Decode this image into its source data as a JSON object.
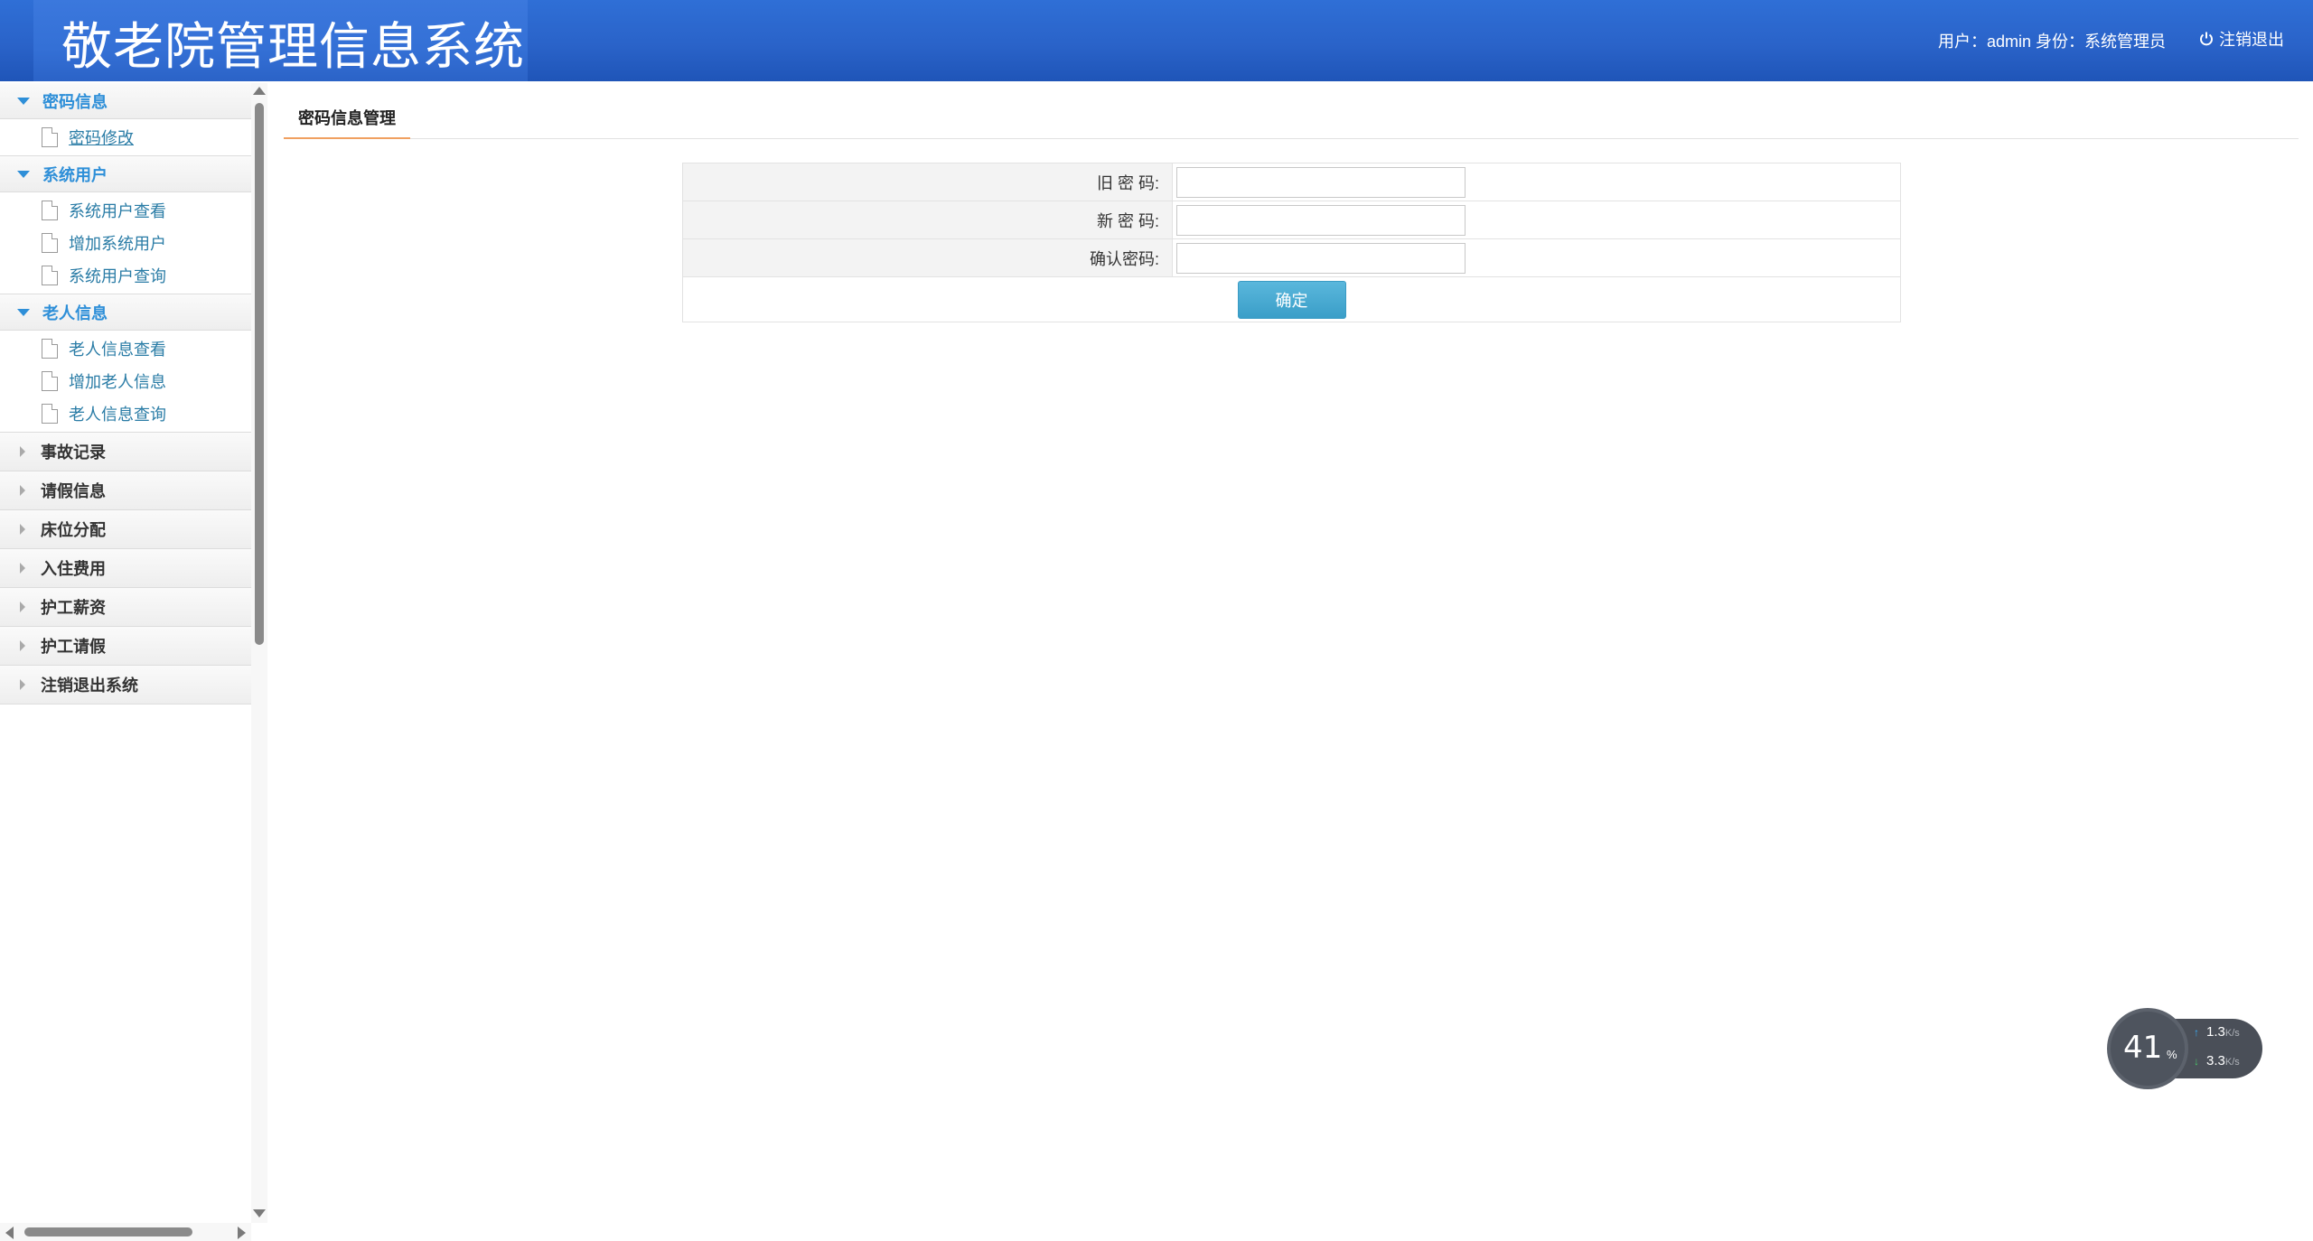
{
  "header": {
    "app_title": "敬老院管理信息系统",
    "user_info": "用户：admin 身份：系统管理员",
    "logout_label": "注销退出"
  },
  "sidebar": {
    "groups": [
      {
        "label": "密码信息",
        "expanded": true,
        "items": [
          {
            "label": "密码修改",
            "active": true
          }
        ]
      },
      {
        "label": "系统用户",
        "expanded": true,
        "items": [
          {
            "label": "系统用户查看"
          },
          {
            "label": "增加系统用户"
          },
          {
            "label": "系统用户查询"
          }
        ]
      },
      {
        "label": "老人信息",
        "expanded": true,
        "items": [
          {
            "label": "老人信息查看"
          },
          {
            "label": "增加老人信息"
          },
          {
            "label": "老人信息查询"
          }
        ]
      },
      {
        "label": "事故记录",
        "expanded": false
      },
      {
        "label": "请假信息",
        "expanded": false
      },
      {
        "label": "床位分配",
        "expanded": false
      },
      {
        "label": "入住费用",
        "expanded": false
      },
      {
        "label": "护工薪资",
        "expanded": false
      },
      {
        "label": "护工请假",
        "expanded": false
      },
      {
        "label": "注销退出系统",
        "expanded": false
      }
    ]
  },
  "main": {
    "tab_label": "密码信息管理",
    "form": {
      "old_password_label": "旧 密 码:",
      "old_password_value": "",
      "new_password_label": "新 密 码:",
      "new_password_value": "",
      "confirm_password_label": "确认密码:",
      "confirm_password_value": "",
      "submit_label": "确定"
    }
  },
  "net_widget": {
    "percent": "41",
    "percent_sign": "%",
    "upload_value": "1.3",
    "upload_unit": "K/s",
    "download_value": "3.3",
    "download_unit": "K/s"
  },
  "colors": {
    "header_blue": "#2a63c9",
    "menu_active_blue": "#2e8fd8",
    "link_teal": "#2a7ca6",
    "tab_underline_orange": "#f0a060",
    "button_blue": "#3a9ec8"
  }
}
